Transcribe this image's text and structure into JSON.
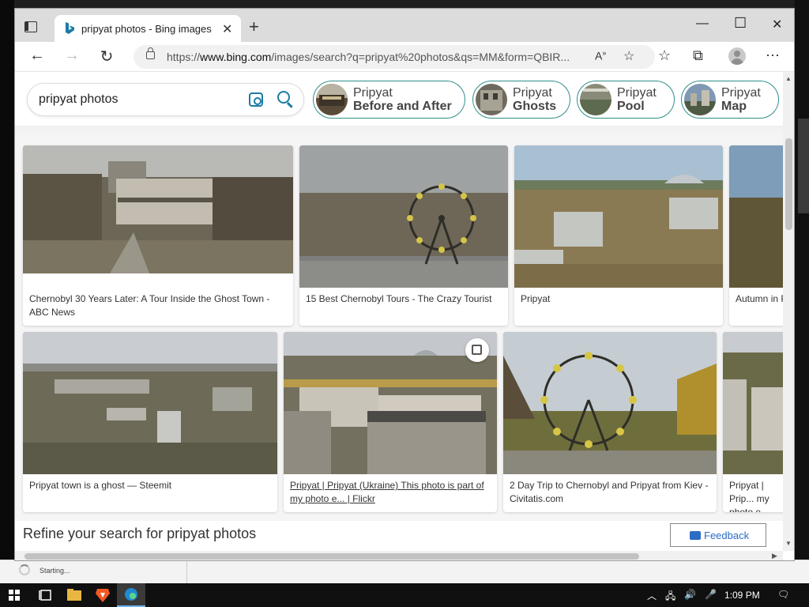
{
  "browser": {
    "tab_title": "pripyat photos - Bing images",
    "close_tab": "✕",
    "new_tab": "+",
    "url_prefix": "https://",
    "url_host": "www.bing.com",
    "url_path": "/images/search?q=pripyat%20photos&qs=MM&form=QBIR...",
    "window_minimize": "—",
    "window_maximize": "☐",
    "window_close": "✕"
  },
  "search": {
    "query": "pripyat photos"
  },
  "chips": [
    {
      "line1": "Pripyat",
      "line2": "Before and After"
    },
    {
      "line1": "Pripyat",
      "line2": "Ghosts"
    },
    {
      "line1": "Pripyat",
      "line2": "Pool"
    },
    {
      "line1": "Pripyat",
      "line2": "Map"
    }
  ],
  "results_row1": [
    {
      "caption": "Chernobyl 30 Years Later: A Tour Inside the Ghost Town - ABC News"
    },
    {
      "caption": "15 Best Chernobyl Tours - The Crazy Tourist"
    },
    {
      "caption": "Pripyat"
    },
    {
      "caption": "Autumn in P... on Behance"
    }
  ],
  "results_row2": [
    {
      "caption": "Pripyat town is a ghost — Steemit"
    },
    {
      "caption": "Pripyat | Pripyat (Ukraine) This photo is part of my photo e... | Flickr"
    },
    {
      "caption": "2 Day Trip to Chernobyl and Pripyat from Kiev - Civitatis.com"
    },
    {
      "caption": "Pripyat | Prip... my photo e..."
    }
  ],
  "refine": {
    "text": "Refine your search for pripyat photos",
    "feedback": "Feedback"
  },
  "status_bar": {
    "text": "Starting..."
  },
  "taskbar": {
    "time": "1:09 PM"
  },
  "colors": {
    "accent": "#1a7ba5",
    "chip_border": "#2d8f8a",
    "feedback_blue": "#2b6cc4"
  }
}
